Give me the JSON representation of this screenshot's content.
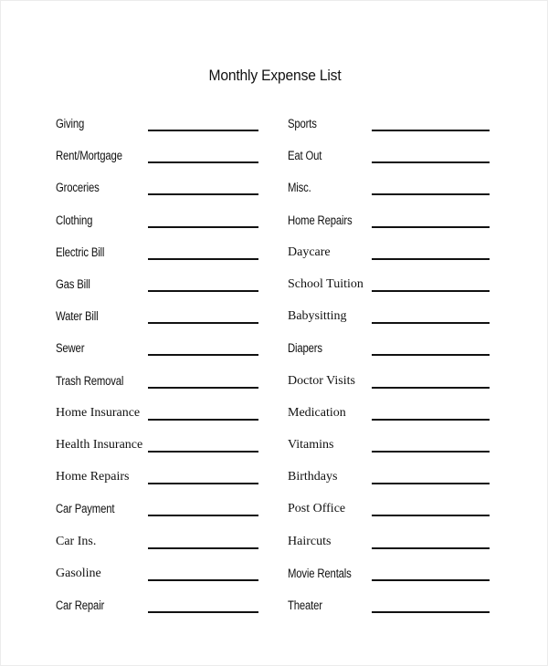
{
  "document": {
    "title": "Monthly Expense List"
  },
  "left_column": [
    {
      "label": "Giving",
      "font": "sans"
    },
    {
      "label": "Rent/Mortgage",
      "font": "sans"
    },
    {
      "label": "Groceries",
      "font": "sans"
    },
    {
      "label": "Clothing",
      "font": "sans"
    },
    {
      "label": "Electric Bill",
      "font": "sans"
    },
    {
      "label": "Gas Bill",
      "font": "sans"
    },
    {
      "label": "Water Bill",
      "font": "sans"
    },
    {
      "label": "Sewer",
      "font": "sans"
    },
    {
      "label": "Trash Removal",
      "font": "sans"
    },
    {
      "label": "Home Insurance",
      "font": "serif"
    },
    {
      "label": "Health Insurance",
      "font": "serif"
    },
    {
      "label": "Home Repairs",
      "font": "serif"
    },
    {
      "label": "Car Payment",
      "font": "sans"
    },
    {
      "label": "Car Ins.",
      "font": "serif"
    },
    {
      "label": "Gasoline",
      "font": "serif"
    },
    {
      "label": "Car Repair",
      "font": "sans"
    }
  ],
  "right_column": [
    {
      "label": "Sports",
      "font": "sans"
    },
    {
      "label": "Eat Out",
      "font": "sans"
    },
    {
      "label": "Misc.",
      "font": "sans"
    },
    {
      "label": "Home Repairs",
      "font": "sans"
    },
    {
      "label": "Daycare",
      "font": "serif"
    },
    {
      "label": "School Tuition",
      "font": "serif"
    },
    {
      "label": "Babysitting",
      "font": "serif"
    },
    {
      "label": "Diapers",
      "font": "sans"
    },
    {
      "label": "Doctor Visits",
      "font": "serif"
    },
    {
      "label": "Medication",
      "font": "serif"
    },
    {
      "label": "Vitamins",
      "font": "serif"
    },
    {
      "label": "Birthdays",
      "font": "serif"
    },
    {
      "label": "Post Office",
      "font": "serif"
    },
    {
      "label": "Haircuts",
      "font": "serif"
    },
    {
      "label": "Movie Rentals",
      "font": "sans"
    },
    {
      "label": "Theater",
      "font": "sans"
    }
  ]
}
